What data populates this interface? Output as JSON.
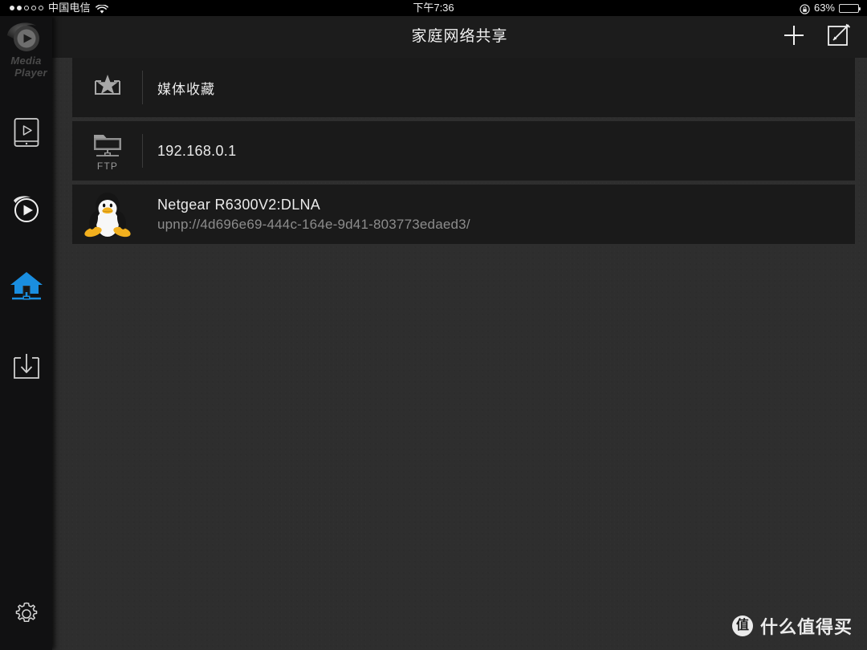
{
  "status_bar": {
    "signal_dots_filled": 2,
    "signal_dots_total": 5,
    "carrier": "中国电信",
    "wifi_icon": "wifi-icon",
    "time": "下午7:36",
    "rotation_lock_icon": "rotation-lock-icon",
    "battery_percent": "63%",
    "battery_level": 63
  },
  "sidebar": {
    "logo": {
      "icon": "media-player-logo-icon",
      "line1": "Media",
      "line2": "Player"
    },
    "items": [
      {
        "id": "local-media",
        "icon": "tablet-play-icon",
        "active": false
      },
      {
        "id": "streaming",
        "icon": "circle-play-icon",
        "active": false
      },
      {
        "id": "home-network",
        "icon": "home-network-icon",
        "active": true
      },
      {
        "id": "downloads",
        "icon": "download-box-icon",
        "active": false
      }
    ],
    "settings": {
      "id": "settings",
      "icon": "gear-icon"
    },
    "active_color": "#1a8ee0"
  },
  "header": {
    "title": "家庭网络共享",
    "actions": [
      {
        "id": "add",
        "icon": "plus-icon"
      },
      {
        "id": "edit",
        "icon": "edit-square-icon"
      }
    ]
  },
  "list": {
    "rows": [
      {
        "id": "media-favorites",
        "icon": "star-collection-icon",
        "title": "媒体收藏",
        "subtitle": "",
        "icon_label": "",
        "divider": true,
        "cjk": true
      },
      {
        "id": "ftp-server",
        "icon": "ftp-folder-icon",
        "title": "192.168.0.1",
        "subtitle": "",
        "icon_label": "FTP",
        "divider": true,
        "cjk": false
      },
      {
        "id": "dlna-netgear",
        "icon": "tux-penguin-icon",
        "title": "Netgear R6300V2:DLNA",
        "subtitle": "upnp://4d696e69-444c-164e-9d41-803773edaed3/",
        "icon_label": "",
        "divider": false,
        "cjk": false
      }
    ]
  },
  "watermark": {
    "badge": "值",
    "text": "什么值得买"
  },
  "colors": {
    "background": "#2e2e2e",
    "row": "#1a1a1a",
    "sidebar": "#111112",
    "header": "#1c1c1c",
    "accent": "#1a8ee0",
    "text_primary": "#eaeaea",
    "text_secondary": "#8c8c8c"
  }
}
